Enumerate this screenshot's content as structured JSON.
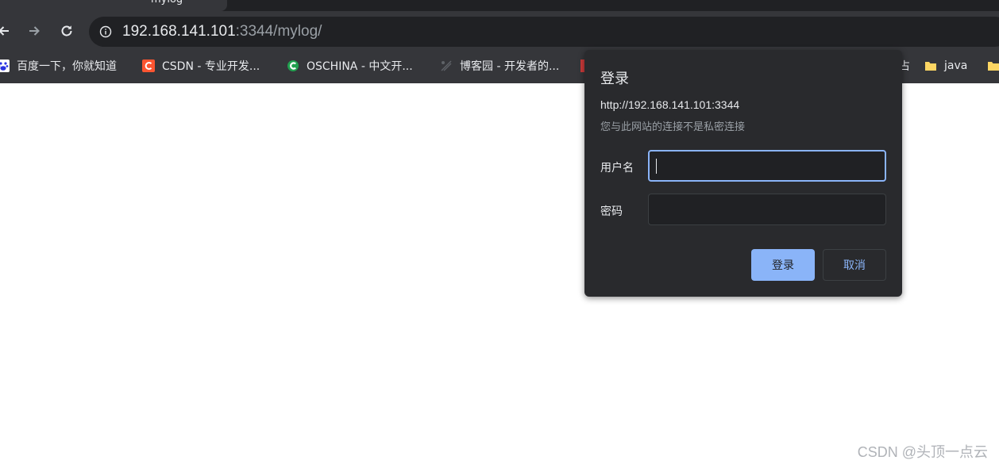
{
  "tab": {
    "title": "mylog"
  },
  "address_bar": {
    "url_host": "192.168.141.101",
    "url_rest": ":3344/mylog/"
  },
  "bookmarks": [
    {
      "label": "百度一下，你就知道",
      "icon": "baidu-paw-icon"
    },
    {
      "label": "CSDN - 专业开发...",
      "icon": "csdn-logo-icon"
    },
    {
      "label": "OSCHINA - 中文开...",
      "icon": "oschina-logo-icon"
    },
    {
      "label": "博客园 - 开发者的...",
      "icon": "cnblogs-logo-icon"
    },
    {
      "label": "占",
      "icon": ""
    },
    {
      "label": "java",
      "icon": "folder-icon"
    },
    {
      "label": "",
      "icon": "folder-icon"
    }
  ],
  "dialog": {
    "title": "登录",
    "origin": "http://192.168.141.101:3344",
    "note": "您与此网站的连接不是私密连接",
    "username_label": "用户名",
    "username_value": "",
    "password_label": "密码",
    "password_value": "",
    "login_button": "登录",
    "cancel_button": "取消"
  },
  "watermark": "CSDN @头顶一点云",
  "colors": {
    "chrome_bg": "#35363a",
    "omnibox_bg": "#202124",
    "dialog_bg": "#292a2d",
    "accent": "#8ab4f8"
  }
}
